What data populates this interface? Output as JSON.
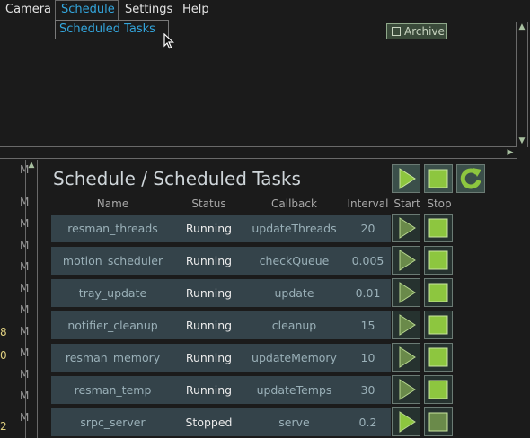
{
  "menubar": {
    "items": [
      {
        "label": "Camera",
        "active": false
      },
      {
        "label": "Schedule",
        "active": true
      },
      {
        "label": "Settings",
        "active": false
      },
      {
        "label": "Help",
        "active": false
      }
    ],
    "dropdown": {
      "items": [
        "Scheduled Tasks"
      ]
    }
  },
  "top_panel": {
    "archive_label": "Archive",
    "archive_checked": false
  },
  "left_column": {
    "visible_numbers": [
      "8",
      "0",
      "2"
    ],
    "m_label": "M"
  },
  "panel": {
    "title": "Schedule / Scheduled Tasks",
    "columns": [
      "Name",
      "Status",
      "Callback",
      "Interval",
      "Start",
      "Stop"
    ],
    "tasks": [
      {
        "name": "resman_threads",
        "status": "Running",
        "callback": "updateThreads",
        "interval": "20"
      },
      {
        "name": "motion_scheduler",
        "status": "Running",
        "callback": "checkQueue",
        "interval": "0.005"
      },
      {
        "name": "tray_update",
        "status": "Running",
        "callback": "update",
        "interval": "0.01"
      },
      {
        "name": "notifier_cleanup",
        "status": "Running",
        "callback": "cleanup",
        "interval": "15"
      },
      {
        "name": "resman_memory",
        "status": "Running",
        "callback": "updateMemory",
        "interval": "10"
      },
      {
        "name": "resman_temp",
        "status": "Running",
        "callback": "updateTemps",
        "interval": "30"
      },
      {
        "name": "srpc_server",
        "status": "Stopped",
        "callback": "serve",
        "interval": "0.2"
      }
    ]
  },
  "colors": {
    "accent": "#33a6dd",
    "button_green": "#8dc63f",
    "row_bg": "#34434a",
    "start_disabled": "#6a8a4a"
  }
}
